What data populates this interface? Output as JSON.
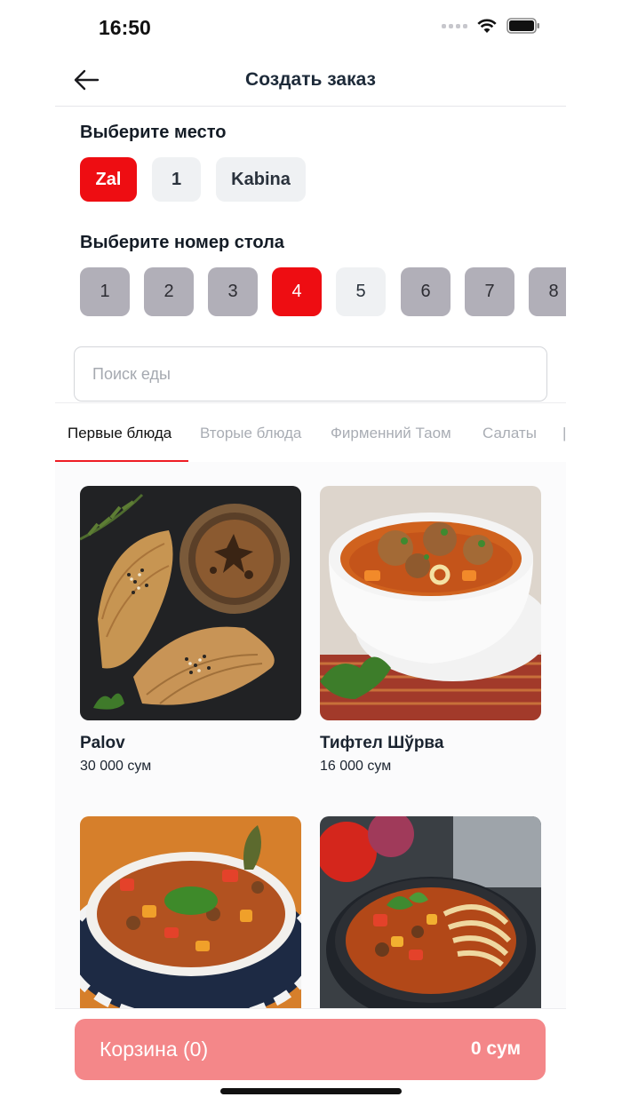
{
  "status_bar": {
    "time": "16:50"
  },
  "header": {
    "title": "Создать заказ"
  },
  "place": {
    "title": "Выберите место",
    "options": [
      "Zal",
      "1",
      "Kabina"
    ],
    "selected": "Zal"
  },
  "table": {
    "title": "Выберите номер стола",
    "numbers": [
      "1",
      "2",
      "3",
      "4",
      "5",
      "6",
      "7",
      "8"
    ],
    "selected": "4"
  },
  "search": {
    "placeholder": "Поиск еды"
  },
  "tabs": [
    "Первые блюда",
    "Вторые блюда",
    "Фирменний Таом",
    "Салаты"
  ],
  "active_tab": "Первые блюда",
  "menu_items": [
    {
      "name": "Palov",
      "price": "30 000 сум"
    },
    {
      "name": "Тифтел Шўрва",
      "price": "16 000 сум"
    }
  ],
  "cart": {
    "label": "Корзина (0)",
    "total": "0 сум"
  },
  "colors": {
    "accent": "#ee0d12",
    "cart_button": "#f48789",
    "table_chip": "#b1afb8"
  }
}
